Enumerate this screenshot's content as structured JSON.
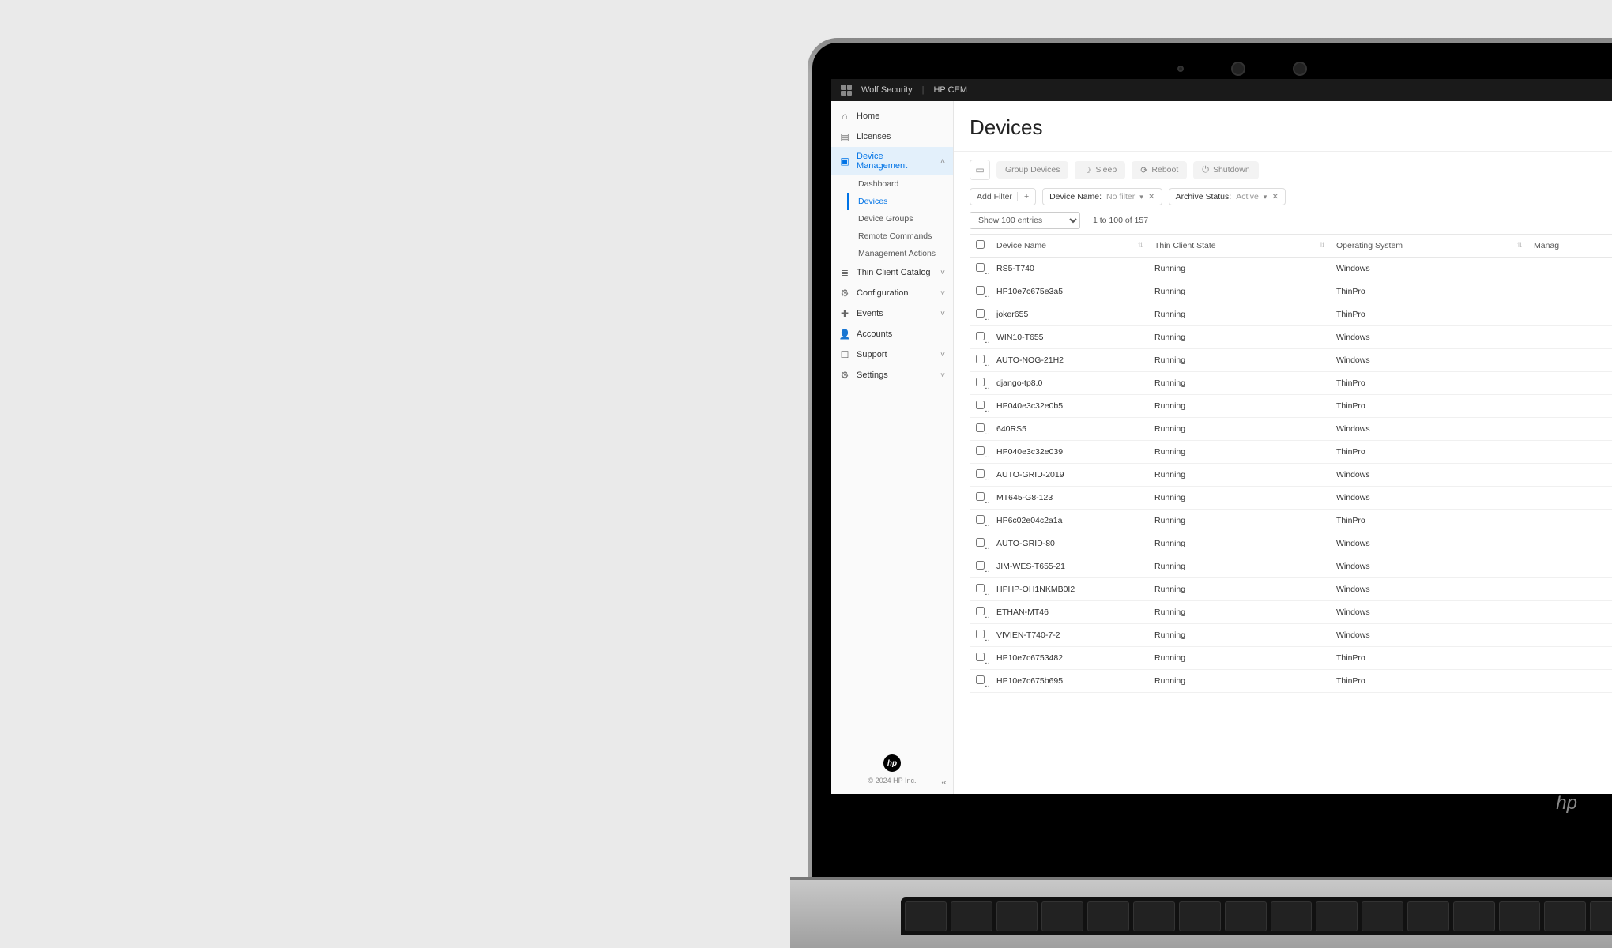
{
  "header": {
    "app1": "Wolf Security",
    "app2": "HP CEM"
  },
  "sidebar": {
    "items": [
      {
        "icon": "home",
        "label": "Home"
      },
      {
        "icon": "license",
        "label": "Licenses"
      },
      {
        "icon": "device",
        "label": "Device Management",
        "active": true,
        "expanded": true
      },
      {
        "icon": "catalog",
        "label": "Thin Client Catalog",
        "chev": true
      },
      {
        "icon": "config",
        "label": "Configuration",
        "chev": true
      },
      {
        "icon": "events",
        "label": "Events",
        "chev": true
      },
      {
        "icon": "accounts",
        "label": "Accounts"
      },
      {
        "icon": "support",
        "label": "Support",
        "chev": true
      },
      {
        "icon": "settings",
        "label": "Settings",
        "chev": true
      }
    ],
    "sub": [
      {
        "label": "Dashboard"
      },
      {
        "label": "Devices",
        "current": true
      },
      {
        "label": "Device Groups"
      },
      {
        "label": "Remote Commands"
      },
      {
        "label": "Management Actions"
      }
    ],
    "footer": "© 2024 HP Inc."
  },
  "page": {
    "title": "Devices"
  },
  "toolbar": {
    "actions": {
      "group": "Group Devices",
      "sleep": "Sleep",
      "reboot": "Reboot",
      "shutdown": "Shutdown"
    }
  },
  "filters": {
    "add": "Add Filter",
    "chips": [
      {
        "label": "Device Name:",
        "value": "No filter"
      },
      {
        "label": "Archive Status:",
        "value": "Active"
      }
    ]
  },
  "pager": {
    "entries_label": "Show 100 entries",
    "range": "1 to 100 of 157"
  },
  "table": {
    "cols": {
      "name": "Device Name",
      "state": "Thin Client State",
      "os": "Operating System",
      "manag": "Manag"
    },
    "rows": [
      {
        "name": "RS5-T740",
        "state": "Running",
        "os": "Windows"
      },
      {
        "name": "HP10e7c675e3a5",
        "state": "Running",
        "os": "ThinPro"
      },
      {
        "name": "joker655",
        "state": "Running",
        "os": "ThinPro"
      },
      {
        "name": "WIN10-T655",
        "state": "Running",
        "os": "Windows"
      },
      {
        "name": "AUTO-NOG-21H2",
        "state": "Running",
        "os": "Windows"
      },
      {
        "name": "django-tp8.0",
        "state": "Running",
        "os": "ThinPro"
      },
      {
        "name": "HP040e3c32e0b5",
        "state": "Running",
        "os": "ThinPro"
      },
      {
        "name": "640RS5",
        "state": "Running",
        "os": "Windows"
      },
      {
        "name": "HP040e3c32e039",
        "state": "Running",
        "os": "ThinPro"
      },
      {
        "name": "AUTO-GRID-2019",
        "state": "Running",
        "os": "Windows"
      },
      {
        "name": "MT645-G8-123",
        "state": "Running",
        "os": "Windows"
      },
      {
        "name": "HP6c02e04c2a1a",
        "state": "Running",
        "os": "ThinPro"
      },
      {
        "name": "AUTO-GRID-80",
        "state": "Running",
        "os": "Windows"
      },
      {
        "name": "JIM-WES-T655-21",
        "state": "Running",
        "os": "Windows"
      },
      {
        "name": "HPHP-OH1NKMB0I2",
        "state": "Running",
        "os": "Windows"
      },
      {
        "name": "ETHAN-MT46",
        "state": "Running",
        "os": "Windows"
      },
      {
        "name": "VIVIEN-T740-7-2",
        "state": "Running",
        "os": "Windows"
      },
      {
        "name": "HP10e7c6753482",
        "state": "Running",
        "os": "ThinPro"
      },
      {
        "name": "HP10e7c675b695",
        "state": "Running",
        "os": "ThinPro"
      }
    ]
  }
}
